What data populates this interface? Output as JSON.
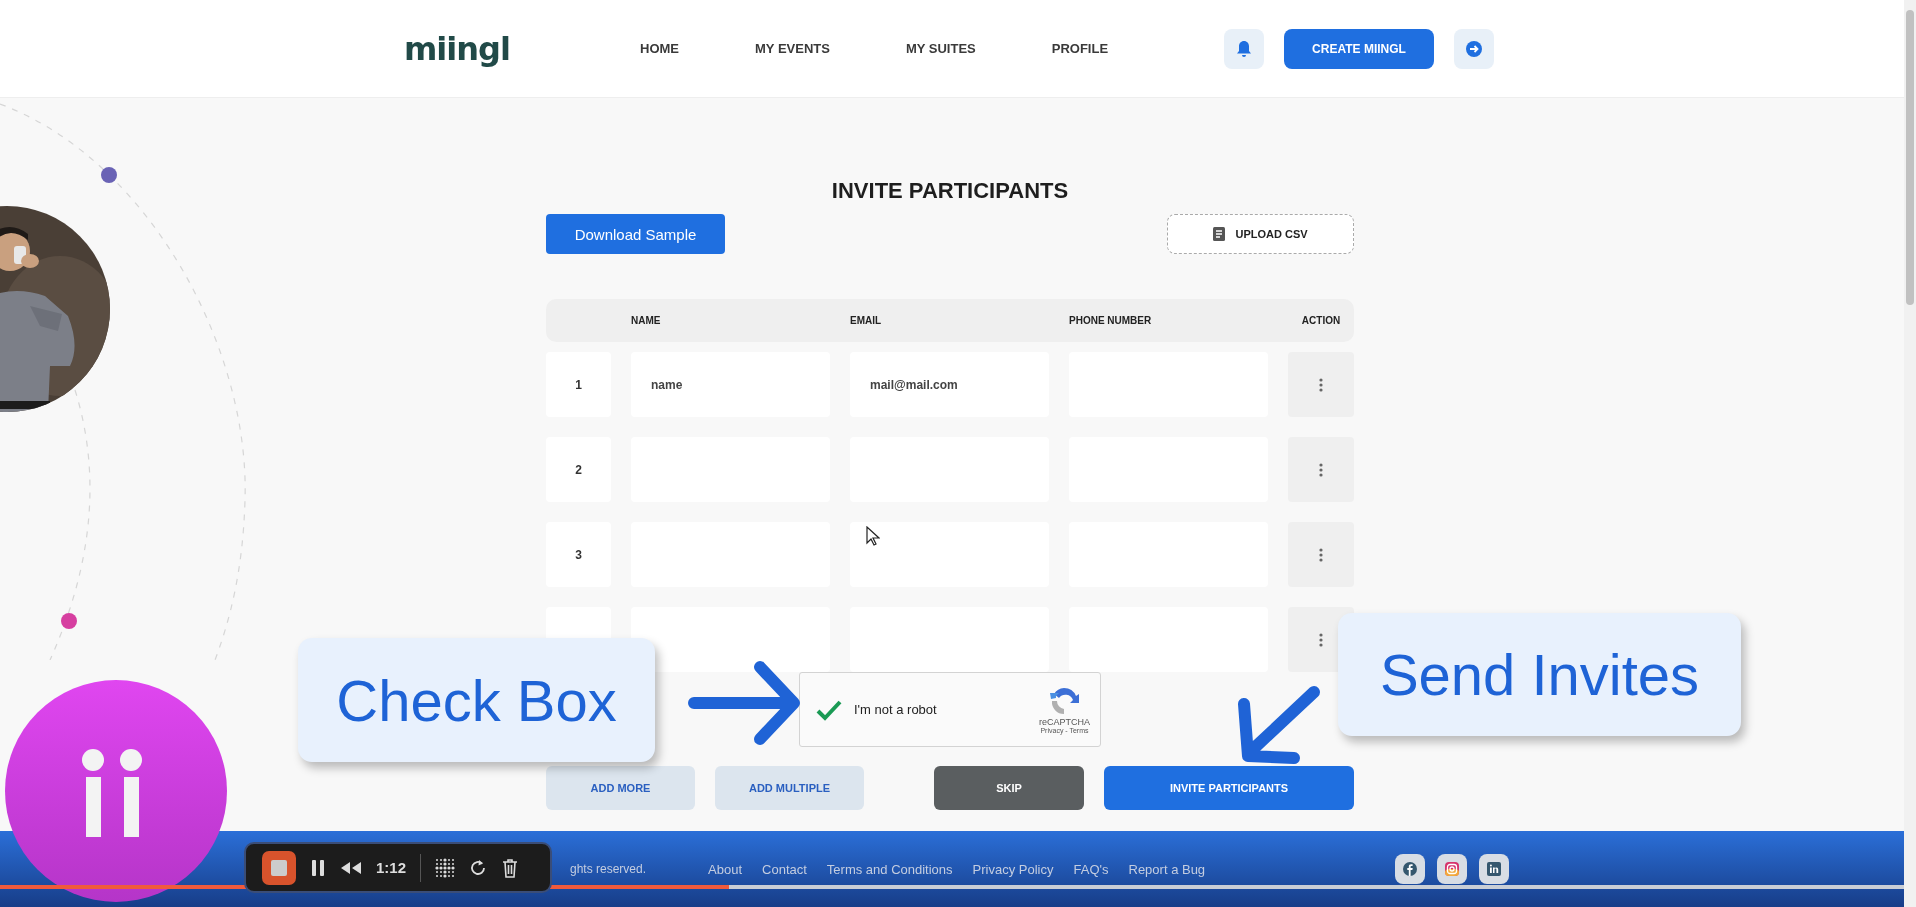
{
  "header": {
    "logo": "miingl",
    "nav": [
      {
        "label": "HOME"
      },
      {
        "label": "MY EVENTS"
      },
      {
        "label": "MY SUITES"
      },
      {
        "label": "PROFILE"
      }
    ],
    "create_button": "CREATE MIINGL"
  },
  "page": {
    "title": "INVITE PARTICIPANTS",
    "download_button": "Download Sample",
    "upload_button": "UPLOAD CSV"
  },
  "table": {
    "columns": [
      "NAME",
      "EMAIL",
      "PHONE NUMBER",
      "ACTION"
    ],
    "rows": [
      {
        "number": "1",
        "name": "name",
        "email": "mail@mail.com"
      },
      {
        "number": "2"
      },
      {
        "number": "3"
      },
      {}
    ]
  },
  "captcha": {
    "checked": true,
    "label": "I'm not a robot",
    "brand": "reCAPTCHA",
    "links": "Privacy - Terms"
  },
  "buttons": [
    {
      "label": "ADD MORE",
      "kind": "secondary"
    },
    {
      "label": "ADD MULTIPLE",
      "kind": "secondary"
    },
    {
      "label": "SKIP",
      "kind": "dark"
    },
    {
      "label": "INVITE PARTICIPANTS",
      "kind": "primary"
    }
  ],
  "footer": {
    "copyright": "ghts reserved.",
    "links": [
      "About",
      "Contact",
      "Terms and Conditions",
      "Privacy Policy",
      "FAQ's",
      "Report a Bug"
    ]
  },
  "callouts": [
    {
      "text": "Check Box"
    },
    {
      "text": "Send Invites"
    }
  ],
  "recorder": {
    "time": "1:12"
  },
  "playback": {
    "level": 0.383
  }
}
